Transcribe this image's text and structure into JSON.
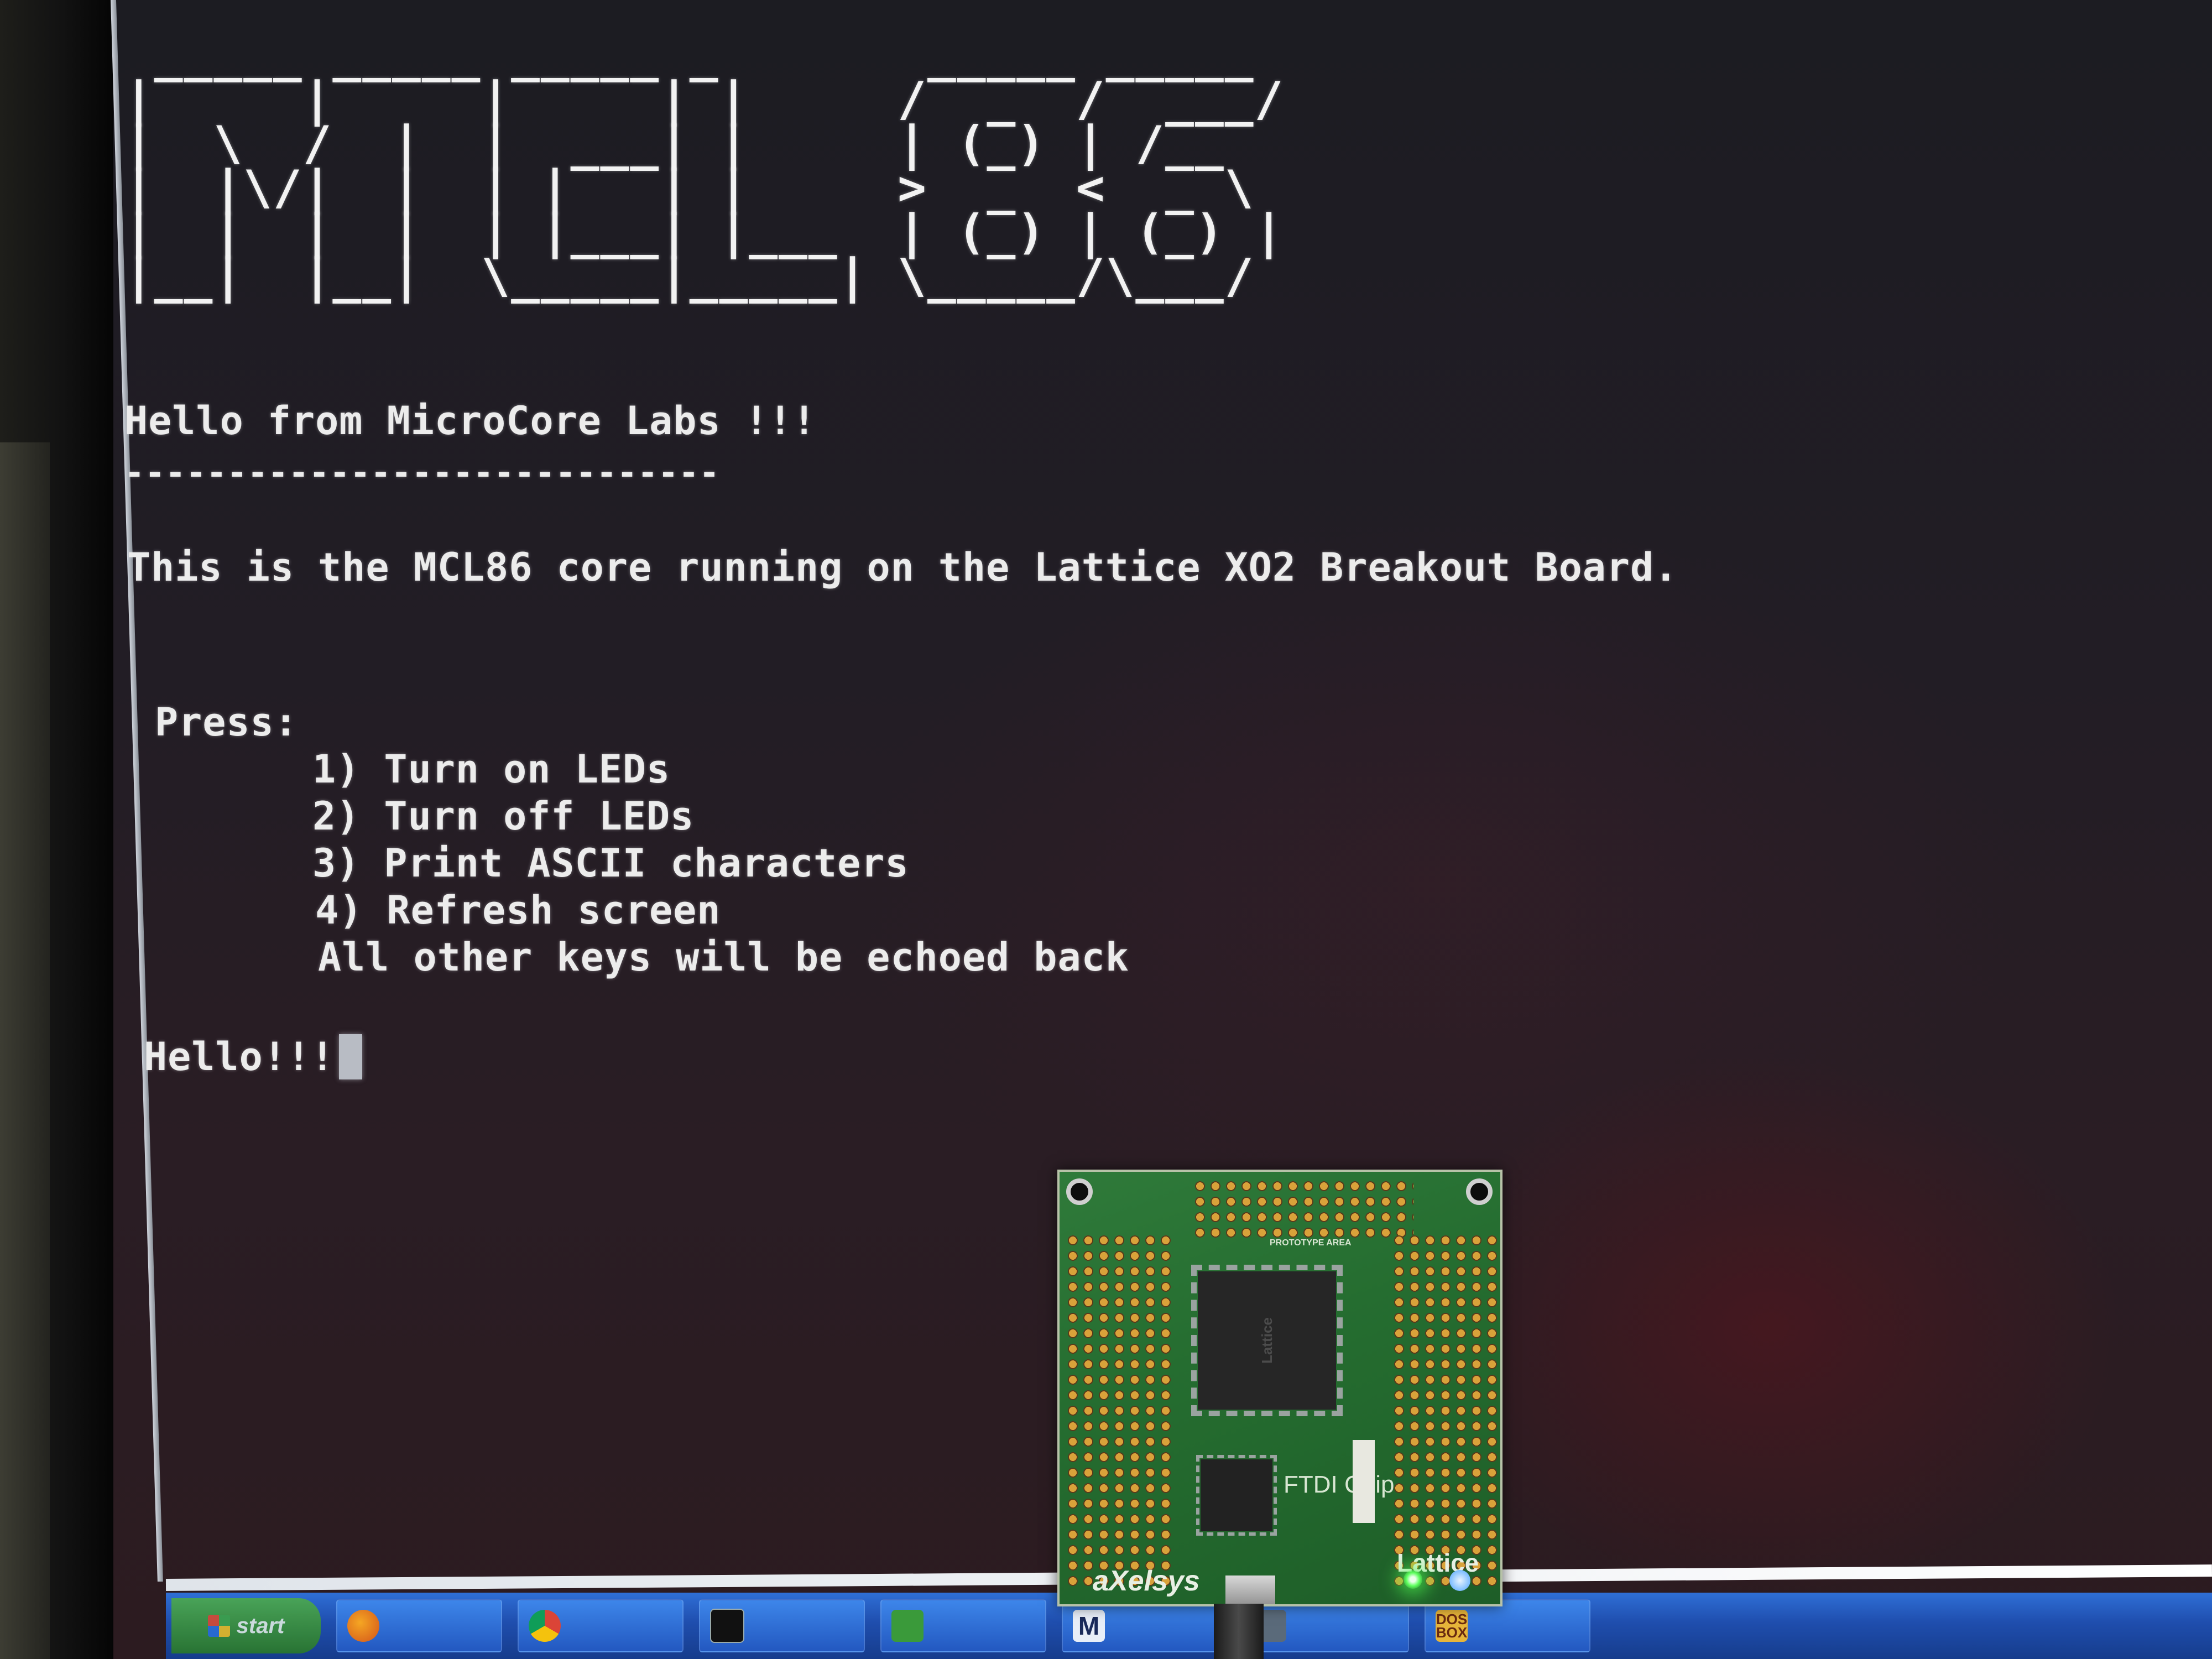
{
  "terminal": {
    "banner_art": " _____ _____ _____ _       _____ _____\n|     |     |     | |     /  _  /  ___/\n|  \\  /  |  |  ___| |     | (_) | /__  \n|  |\\/|  |  | |   | |     >  _  <  _ \\ \n|  |  |  |  | |___| |___  | (_) | (_) |\n|__|  |__|  \\_____|_____| \\_____/\\___/ ",
    "heading": "Hello from MicroCore Labs !!!",
    "divider": "-----------------------------",
    "intro": "This is the MCL86 core running on the Lattice XO2 Breakout Board.",
    "press_label": "Press:",
    "options": [
      "1) Turn on LEDs",
      "2) Turn off LEDs",
      "3) Print ASCII characters",
      "4) Refresh screen"
    ],
    "echo_note": "All other keys will be echoed back",
    "input_line": "Hello!!!"
  },
  "board": {
    "proto_label": "PROTOTYPE AREA",
    "ftdi_label": "FTDI Chip",
    "vendor_logo": "Lattice",
    "maker_logo": "aXelsys",
    "led_color": "#5cff5c"
  },
  "taskbar": {
    "start_label": "start",
    "items": [
      {
        "icon": "firefox-icon"
      },
      {
        "icon": "chrome-icon"
      },
      {
        "icon": "terminal-icon"
      },
      {
        "icon": "green-app-icon"
      },
      {
        "icon": "m-app-icon",
        "glyph": "M"
      },
      {
        "icon": "lattice-icon"
      },
      {
        "icon": "dosbox-icon",
        "glyph": "DOS BOX"
      }
    ]
  }
}
